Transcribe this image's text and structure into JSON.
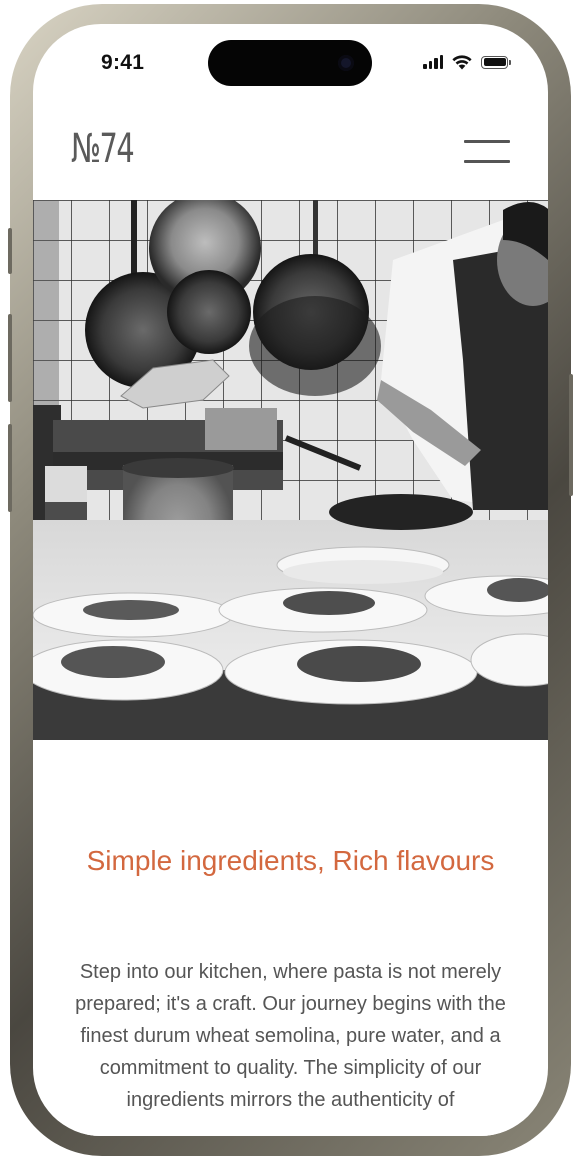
{
  "status_bar": {
    "time": "9:41"
  },
  "header": {
    "logo": "№74"
  },
  "hero": {
    "alt": "Chef plating pasta dishes in a restaurant kitchen"
  },
  "content": {
    "heading": "Simple ingredients, Rich flavours",
    "body": "Step into our kitchen, where pasta is not merely prepared; it's a craft. Our journey begins with the finest durum wheat semolina, pure water, and a commitment to quality. The simplicity of our ingredients mirrors the authenticity of"
  },
  "colors": {
    "accent": "#d3683f",
    "body_text": "#555555"
  },
  "icons": {
    "menu": "hamburger-menu-icon",
    "signal": "cellular-signal-icon",
    "wifi": "wifi-icon",
    "battery": "battery-icon"
  }
}
